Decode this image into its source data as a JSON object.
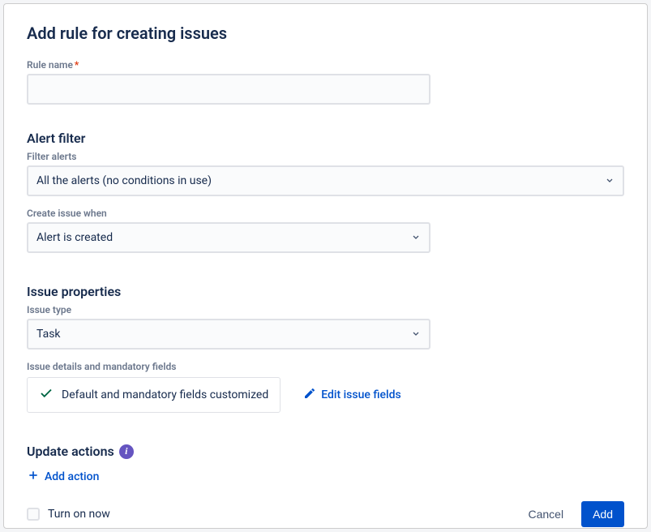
{
  "dialog": {
    "title": "Add rule for creating issues"
  },
  "ruleName": {
    "label": "Rule name",
    "value": ""
  },
  "alertFilter": {
    "heading": "Alert filter",
    "filterAlerts": {
      "label": "Filter alerts",
      "value": "All the alerts (no conditions in use)"
    },
    "createWhen": {
      "label": "Create issue when",
      "value": "Alert is created"
    }
  },
  "issueProperties": {
    "heading": "Issue properties",
    "issueType": {
      "label": "Issue type",
      "value": "Task"
    },
    "detailsLabel": "Issue details and mandatory fields",
    "statusText": "Default and mandatory fields customized",
    "editLink": "Edit issue fields"
  },
  "updateActions": {
    "heading": "Update actions",
    "addLink": "Add action"
  },
  "footer": {
    "turnOn": "Turn on now",
    "cancel": "Cancel",
    "add": "Add"
  }
}
